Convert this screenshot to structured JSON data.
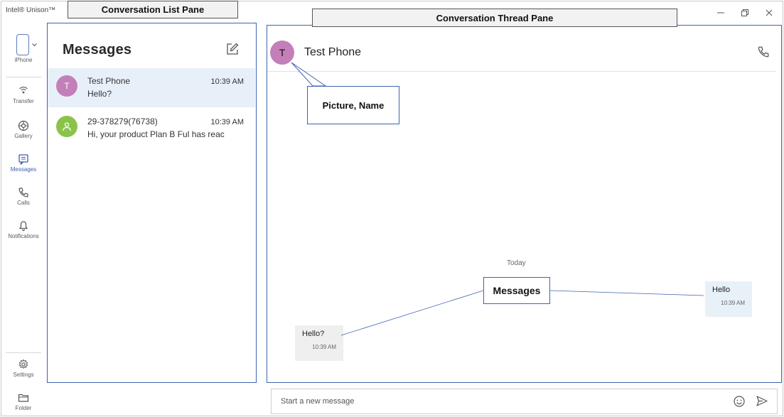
{
  "app": {
    "title": "Intel® Unison™",
    "accent": "#3d5ea8",
    "window_controls": [
      "minimize-icon",
      "restore-icon",
      "close-icon"
    ]
  },
  "annotations": {
    "list_pane": "Conversation List Pane",
    "thread_pane": "Conversation Thread Pane",
    "picture_name": "Picture, Name",
    "messages": "Messages"
  },
  "rail": {
    "device": "iPhone",
    "items": [
      {
        "label": "Transfer",
        "icon": "transfer-icon"
      },
      {
        "label": "Gallery",
        "icon": "gallery-icon"
      },
      {
        "label": "Messages",
        "icon": "messages-icon",
        "active": true
      },
      {
        "label": "Calls",
        "icon": "phone-icon"
      },
      {
        "label": "Notifications",
        "icon": "bell-icon"
      }
    ],
    "bottom": [
      {
        "label": "Settings",
        "icon": "gear-icon"
      },
      {
        "label": "Folder",
        "icon": "folder-icon"
      }
    ]
  },
  "list": {
    "title": "Messages",
    "conversations": [
      {
        "initial": "T",
        "name": "Test Phone",
        "time": "10:39 AM",
        "preview": "Hello?",
        "avatar_color": "#c47fb9",
        "selected": true
      },
      {
        "initial": "",
        "name": "29-378279(76738)",
        "time": "10:39 AM",
        "preview": "Hi, your product Plan B Ful has reac",
        "avatar_color": "#8bc34a",
        "avatar_icon": "person-icon"
      }
    ]
  },
  "thread": {
    "initial": "T",
    "name": "Test Phone",
    "day": "Today",
    "messages": [
      {
        "direction": "out",
        "text": "Hello",
        "time": "10:39 AM"
      },
      {
        "direction": "in",
        "text": "Hello?",
        "time": "10:39 AM"
      }
    ]
  },
  "compose": {
    "placeholder": "Start a new message"
  }
}
